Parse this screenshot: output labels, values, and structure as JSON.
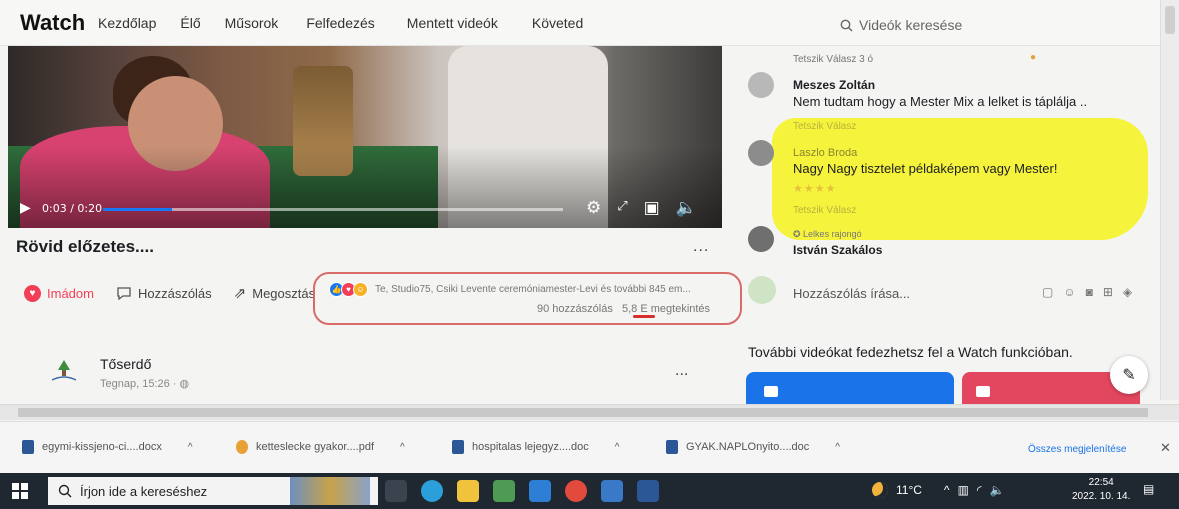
{
  "nav": {
    "brand": "Watch",
    "links": [
      "Kezdőlap",
      "Élő",
      "Műsorok",
      "Felfedezés",
      "Mentett videók",
      "Követed"
    ],
    "search_placeholder": "Videók keresése"
  },
  "video": {
    "time": "0:03 / 0:20",
    "progress_fraction": 0.15,
    "title": "Rövid előzetes....",
    "more": "..."
  },
  "actions": {
    "love": "Imádom",
    "comment": "Hozzászólás",
    "share": "Megosztás"
  },
  "reactions": {
    "names": "Te, Studio75, Csiki Levente ceremóniamester-Levi és további 845 em...",
    "comments": "90 hozzászólás",
    "views": "5,8 E megtekintés"
  },
  "next_post": {
    "page_name": "Tőserdő",
    "time": "Tegnap, 15:26 · ",
    "more": "..."
  },
  "comments": [
    {
      "name": "",
      "text": "",
      "meta": "Tetszik  Válasz  3 ó"
    },
    {
      "name": "Meszes Zoltán",
      "text": "Nem tudtam hogy a Mester Mix a lelket is táplálja ..",
      "meta": "Tetszik  Válasz"
    },
    {
      "name": "Laszlo Broda",
      "text": "Nagy Nagy tisztelet példaképem vagy Mester!",
      "meta": "Tetszik  Válasz"
    },
    {
      "badge": "Lelkes rajongó",
      "name": "István Szakálos",
      "text": "",
      "meta": ""
    }
  ],
  "write_placeholder": "Hozzászólás írása...",
  "more_videos": "További videókat fedezhetsz fel a Watch funkcióban.",
  "downloads": {
    "items": [
      "egymi-kissjeno-ci....docx",
      "ketteslecke gyakor....pdf",
      "hospitalas lejegyz....doc",
      "GYAK.NAPLOnyito....doc"
    ],
    "show_all": "Összes megjelenítése"
  },
  "taskbar": {
    "search": "Írjon ide a kereséshez",
    "temp": "11°C",
    "time": "22:54",
    "date": "2022. 10. 14."
  },
  "colors": {
    "accent": "#1877f2",
    "love": "#f33e58",
    "highlight": "#f6f33c",
    "annotation": "#d86a6a"
  }
}
